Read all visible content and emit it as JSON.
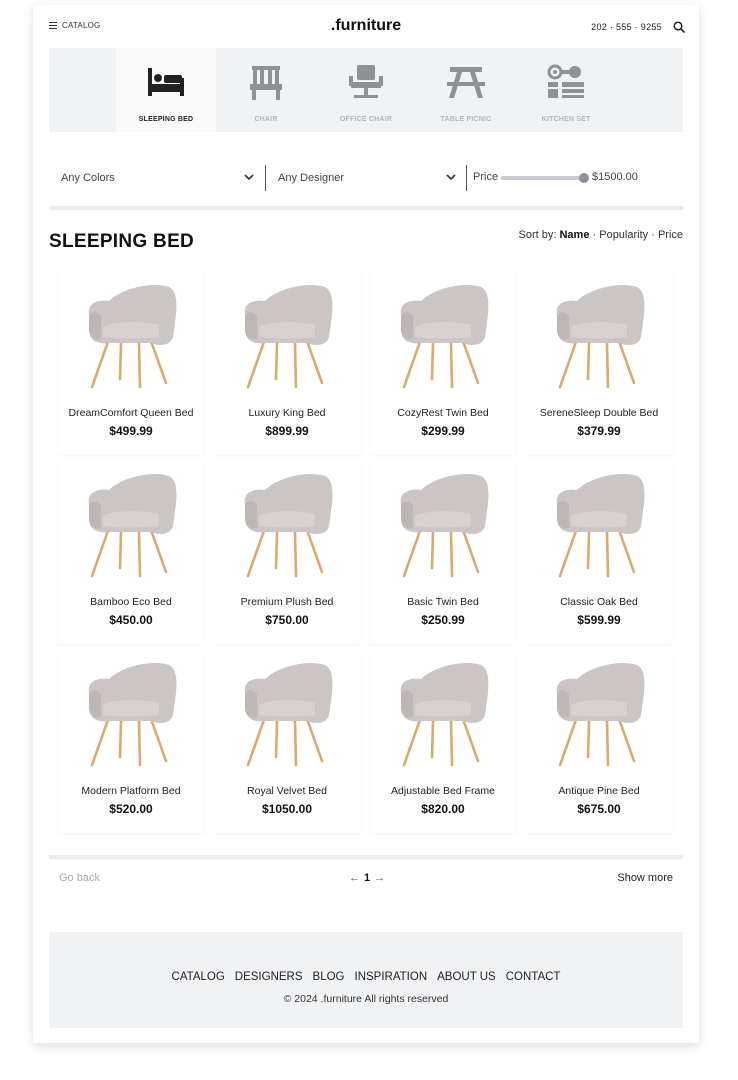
{
  "header": {
    "catalog_label": "CATALOG",
    "brand": ".furniture",
    "phone": "202 · 555 · 9255"
  },
  "categories": [
    {
      "label": "SLEEPING BED",
      "icon": "bed-icon",
      "active": true
    },
    {
      "label": "CHAIR",
      "icon": "chair-icon",
      "active": false
    },
    {
      "label": "OFFICE CHAIR",
      "icon": "office-chair-icon",
      "active": false
    },
    {
      "label": "TABLE PICNIC",
      "icon": "picnic-table-icon",
      "active": false
    },
    {
      "label": "KITCHEN SET",
      "icon": "kitchen-set-icon",
      "active": false
    }
  ],
  "filters": {
    "color": "Any Colors",
    "designer": "Any Designer",
    "price_label": "Price",
    "price_value": "$1500.00",
    "price_slider_fraction": 1.0
  },
  "section": {
    "title": "SLEEPING BED",
    "sort_prefix": "Sort by:",
    "sort_name": "Name",
    "sort_sep1": " · ",
    "sort_popularity": "Popularity",
    "sort_sep2": " · ",
    "sort_price": "Price"
  },
  "products": [
    {
      "name": "DreamComfort Queen Bed",
      "price": "$499.99"
    },
    {
      "name": "Luxury King Bed",
      "price": "$899.99"
    },
    {
      "name": "CozyRest Twin Bed",
      "price": "$299.99"
    },
    {
      "name": "SereneSleep Double Bed",
      "price": "$379.99"
    },
    {
      "name": "Bamboo Eco Bed",
      "price": "$450.00"
    },
    {
      "name": "Premium Plush Bed",
      "price": "$750.00"
    },
    {
      "name": "Basic Twin Bed",
      "price": "$250.99"
    },
    {
      "name": "Classic Oak Bed",
      "price": "$599.99"
    },
    {
      "name": "Modern Platform Bed",
      "price": "$520.00"
    },
    {
      "name": "Royal Velvet Bed",
      "price": "$1050.00"
    },
    {
      "name": "Adjustable Bed Frame",
      "price": "$820.00"
    },
    {
      "name": "Antique Pine Bed",
      "price": "$675.00"
    }
  ],
  "pagination": {
    "go_back": "Go back",
    "prev": "←",
    "current": "1",
    "next": "→",
    "show_more": "Show more"
  },
  "footer": {
    "nav": [
      "CATALOG",
      "DESIGNERS",
      "BLOG",
      "INSPIRATION",
      "ABOUT US",
      "CONTACT"
    ],
    "copyright": "© 2024 .furniture All rights reserved"
  },
  "colors": {
    "panel_bg": "#f1f2f4",
    "icon_active": "#222222",
    "icon_inactive": "#8e9196",
    "chair_fabric": "#cbc6c3",
    "chair_wood": "#d9aa6c"
  }
}
